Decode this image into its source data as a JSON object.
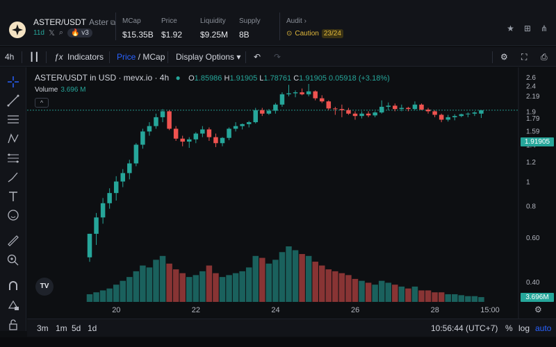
{
  "header": {
    "pair": "ASTER/USDT",
    "pair_sub": "Aster",
    "age": "11d",
    "version": "v3",
    "stats": [
      {
        "label": "MCap",
        "value": "$15.35B"
      },
      {
        "label": "Price",
        "value": "$1.92"
      },
      {
        "label": "Liquidity",
        "value": "$9.25M"
      },
      {
        "label": "Supply",
        "value": "8B"
      }
    ],
    "audit_label": "Audit",
    "caution_label": "Caution",
    "caution_score": "23/24"
  },
  "toolbar": {
    "interval": "4h",
    "indicators": "Indicators",
    "price": "Price",
    "slash": " / ",
    "mcap": "MCap",
    "display_options": "Display Options"
  },
  "legend": {
    "title": "ASTER/USDT in USD · mevx.io · 4h",
    "o_label": "O",
    "o": "1.85986",
    "h_label": "H",
    "h": "1.91905",
    "l_label": "L",
    "l": "1.78761",
    "c_label": "C",
    "c": "1.91905",
    "change": "0.05918 (+3.18%)",
    "volume_label": "Volume",
    "volume": "3.696 M"
  },
  "bottom": {
    "ranges": [
      "3m",
      "1m",
      "5d",
      "1d"
    ],
    "clock": "10:56:44 (UTC+7)",
    "pct": "%",
    "log": "log",
    "auto": "auto"
  },
  "colors": {
    "up": "#26a69a",
    "down": "#ef5350",
    "accent": "#2962ff",
    "caution": "#e2b93b"
  },
  "chart_data": {
    "type": "candlestick",
    "title": "ASTER/USDT in USD · mevx.io · 4h",
    "x_tick_labels": [
      "20",
      "22",
      "24",
      "26",
      "28",
      "15:00"
    ],
    "y_tick_labels": [
      "2.6",
      "2.4",
      "2.19",
      "1.9",
      "1.79",
      "1.59",
      "1.4",
      "1.2",
      "1",
      "0.8",
      "0.60",
      "0.40"
    ],
    "last_price_label": "1.91905",
    "last_volume_label": "3.696M",
    "candles": [
      {
        "o": 0.5,
        "h": 0.62,
        "l": 0.48,
        "c": 0.62
      },
      {
        "o": 0.62,
        "h": 0.75,
        "l": 0.56,
        "c": 0.72
      },
      {
        "o": 0.72,
        "h": 0.86,
        "l": 0.68,
        "c": 0.82
      },
      {
        "o": 0.82,
        "h": 0.94,
        "l": 0.78,
        "c": 0.9
      },
      {
        "o": 0.9,
        "h": 1.05,
        "l": 0.84,
        "c": 1.0
      },
      {
        "o": 1.0,
        "h": 1.12,
        "l": 0.95,
        "c": 1.08
      },
      {
        "o": 1.08,
        "h": 1.22,
        "l": 1.02,
        "c": 1.18
      },
      {
        "o": 1.18,
        "h": 1.42,
        "l": 1.15,
        "c": 1.4
      },
      {
        "o": 1.4,
        "h": 1.62,
        "l": 1.35,
        "c": 1.58
      },
      {
        "o": 1.58,
        "h": 1.72,
        "l": 1.52,
        "c": 1.66
      },
      {
        "o": 1.66,
        "h": 1.86,
        "l": 1.62,
        "c": 1.8
      },
      {
        "o": 1.8,
        "h": 1.94,
        "l": 1.72,
        "c": 1.9
      },
      {
        "o": 1.9,
        "h": 1.92,
        "l": 1.6,
        "c": 1.62
      },
      {
        "o": 1.62,
        "h": 1.66,
        "l": 1.45,
        "c": 1.48
      },
      {
        "o": 1.48,
        "h": 1.52,
        "l": 1.38,
        "c": 1.44
      },
      {
        "o": 1.44,
        "h": 1.5,
        "l": 1.36,
        "c": 1.47
      },
      {
        "o": 1.47,
        "h": 1.57,
        "l": 1.42,
        "c": 1.55
      },
      {
        "o": 1.55,
        "h": 1.66,
        "l": 1.5,
        "c": 1.61
      },
      {
        "o": 1.61,
        "h": 1.64,
        "l": 1.45,
        "c": 1.5
      },
      {
        "o": 1.5,
        "h": 1.55,
        "l": 1.37,
        "c": 1.42
      },
      {
        "o": 1.42,
        "h": 1.5,
        "l": 1.38,
        "c": 1.49
      },
      {
        "o": 1.49,
        "h": 1.64,
        "l": 1.46,
        "c": 1.62
      },
      {
        "o": 1.62,
        "h": 1.72,
        "l": 1.58,
        "c": 1.66
      },
      {
        "o": 1.66,
        "h": 1.7,
        "l": 1.61,
        "c": 1.69
      },
      {
        "o": 1.69,
        "h": 1.74,
        "l": 1.64,
        "c": 1.72
      },
      {
        "o": 1.72,
        "h": 1.96,
        "l": 1.7,
        "c": 1.92
      },
      {
        "o": 1.92,
        "h": 1.96,
        "l": 1.82,
        "c": 1.86
      },
      {
        "o": 1.86,
        "h": 1.94,
        "l": 1.84,
        "c": 1.91
      },
      {
        "o": 1.91,
        "h": 2.05,
        "l": 1.86,
        "c": 2.02
      },
      {
        "o": 2.02,
        "h": 2.26,
        "l": 1.98,
        "c": 2.22
      },
      {
        "o": 2.22,
        "h": 2.42,
        "l": 2.18,
        "c": 2.24
      },
      {
        "o": 2.24,
        "h": 2.3,
        "l": 2.16,
        "c": 2.26
      },
      {
        "o": 2.26,
        "h": 2.34,
        "l": 2.2,
        "c": 2.22
      },
      {
        "o": 2.22,
        "h": 2.44,
        "l": 2.18,
        "c": 2.28
      },
      {
        "o": 2.28,
        "h": 2.3,
        "l": 2.1,
        "c": 2.14
      },
      {
        "o": 2.14,
        "h": 2.2,
        "l": 2.05,
        "c": 2.08
      },
      {
        "o": 2.08,
        "h": 2.1,
        "l": 1.92,
        "c": 1.95
      },
      {
        "o": 1.95,
        "h": 1.98,
        "l": 1.84,
        "c": 1.94
      },
      {
        "o": 1.94,
        "h": 2.02,
        "l": 1.8,
        "c": 1.92
      },
      {
        "o": 1.92,
        "h": 1.96,
        "l": 1.84,
        "c": 1.86
      },
      {
        "o": 1.86,
        "h": 1.9,
        "l": 1.76,
        "c": 1.82
      },
      {
        "o": 1.82,
        "h": 1.9,
        "l": 1.78,
        "c": 1.86
      },
      {
        "o": 1.86,
        "h": 1.9,
        "l": 1.8,
        "c": 1.83
      },
      {
        "o": 1.83,
        "h": 1.9,
        "l": 1.8,
        "c": 1.88
      },
      {
        "o": 1.88,
        "h": 2.1,
        "l": 1.86,
        "c": 1.98
      },
      {
        "o": 1.98,
        "h": 2.06,
        "l": 1.92,
        "c": 2.0
      },
      {
        "o": 2.0,
        "h": 2.04,
        "l": 1.9,
        "c": 1.94
      },
      {
        "o": 1.94,
        "h": 2.02,
        "l": 1.9,
        "c": 1.96
      },
      {
        "o": 1.96,
        "h": 1.98,
        "l": 1.9,
        "c": 1.94
      },
      {
        "o": 1.94,
        "h": 2.08,
        "l": 1.92,
        "c": 2.02
      },
      {
        "o": 2.02,
        "h": 2.04,
        "l": 1.92,
        "c": 1.93
      },
      {
        "o": 1.93,
        "h": 1.96,
        "l": 1.86,
        "c": 1.9
      },
      {
        "o": 1.9,
        "h": 1.92,
        "l": 1.8,
        "c": 1.84
      },
      {
        "o": 1.84,
        "h": 1.86,
        "l": 1.72,
        "c": 1.76
      },
      {
        "o": 1.76,
        "h": 1.84,
        "l": 1.73,
        "c": 1.8
      },
      {
        "o": 1.8,
        "h": 1.85,
        "l": 1.75,
        "c": 1.82
      },
      {
        "o": 1.82,
        "h": 1.86,
        "l": 1.8,
        "c": 1.85
      },
      {
        "o": 1.85,
        "h": 1.88,
        "l": 1.8,
        "c": 1.86
      },
      {
        "o": 1.86,
        "h": 1.9,
        "l": 1.82,
        "c": 1.88
      },
      {
        "o": 1.85986,
        "h": 1.91905,
        "l": 1.78761,
        "c": 1.91905
      }
    ],
    "volumes": [
      0.4,
      0.5,
      0.6,
      0.7,
      0.9,
      1.1,
      1.3,
      1.6,
      1.9,
      1.8,
      2.2,
      2.4,
      2.0,
      1.7,
      1.5,
      1.3,
      1.4,
      1.6,
      1.9,
      1.5,
      1.3,
      1.4,
      1.5,
      1.6,
      1.8,
      2.4,
      2.3,
      2.0,
      2.2,
      2.6,
      2.9,
      2.7,
      2.5,
      2.4,
      2.1,
      1.9,
      1.7,
      1.6,
      1.5,
      1.4,
      1.2,
      1.1,
      1.0,
      0.9,
      1.1,
      1.0,
      0.9,
      0.8,
      0.7,
      0.8,
      0.6,
      0.6,
      0.5,
      0.5,
      0.4,
      0.4,
      0.35,
      0.3,
      0.3,
      0.25
    ],
    "ylim": [
      0.35,
      2.7
    ],
    "scale": "log",
    "grid": false
  }
}
